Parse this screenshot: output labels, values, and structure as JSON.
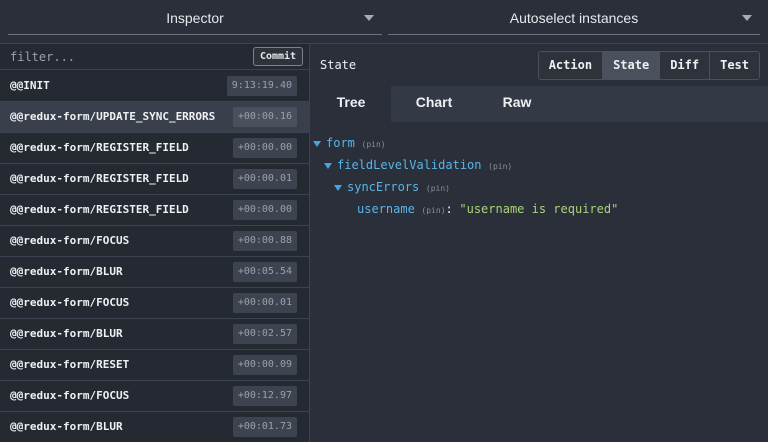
{
  "topbar": {
    "left_select": "Inspector",
    "right_select": "Autoselect instances"
  },
  "filter": {
    "placeholder": "filter...",
    "commit_label": "Commit"
  },
  "actions": [
    {
      "name": "@@INIT",
      "time": "9:13:19.40",
      "selected": false
    },
    {
      "name": "@@redux-form/UPDATE_SYNC_ERRORS",
      "time": "+00:00.16",
      "selected": true
    },
    {
      "name": "@@redux-form/REGISTER_FIELD",
      "time": "+00:00.00",
      "selected": false
    },
    {
      "name": "@@redux-form/REGISTER_FIELD",
      "time": "+00:00.01",
      "selected": false
    },
    {
      "name": "@@redux-form/REGISTER_FIELD",
      "time": "+00:00.00",
      "selected": false
    },
    {
      "name": "@@redux-form/FOCUS",
      "time": "+00:00.88",
      "selected": false
    },
    {
      "name": "@@redux-form/BLUR",
      "time": "+00:05.54",
      "selected": false
    },
    {
      "name": "@@redux-form/FOCUS",
      "time": "+00:00.01",
      "selected": false
    },
    {
      "name": "@@redux-form/BLUR",
      "time": "+00:02.57",
      "selected": false
    },
    {
      "name": "@@redux-form/RESET",
      "time": "+00:00.09",
      "selected": false
    },
    {
      "name": "@@redux-form/FOCUS",
      "time": "+00:12.97",
      "selected": false
    },
    {
      "name": "@@redux-form/BLUR",
      "time": "+00:01.73",
      "selected": false
    }
  ],
  "right": {
    "title": "State",
    "tabs": [
      "Action",
      "State",
      "Diff",
      "Test"
    ],
    "active_tab": "State",
    "subtabs": [
      "Tree",
      "Chart",
      "Raw"
    ],
    "active_subtab": "Tree"
  },
  "tree": {
    "form_key": "form",
    "pin_label": "(pin)",
    "field_key": "fieldLevelValidation",
    "sync_key": "syncErrors",
    "leaf_key": "username",
    "leaf_value": "\"username is required\"",
    "colon": ":"
  },
  "colors": {
    "background": "#2a2f3a",
    "list_background": "#252932",
    "selected_row": "#3a404b",
    "key_color": "#59b6e8",
    "string_color": "#a8d47a"
  }
}
